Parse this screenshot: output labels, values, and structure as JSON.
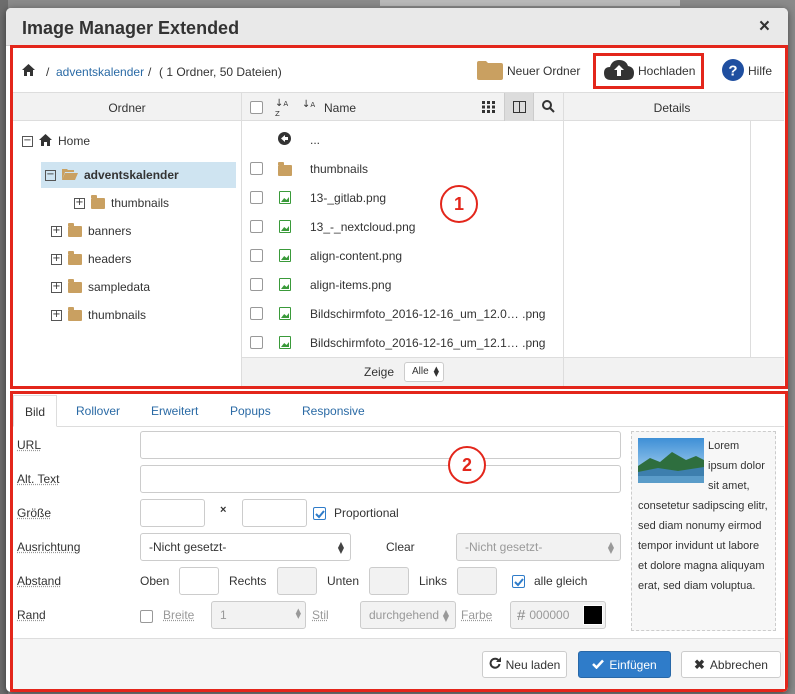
{
  "dialog": {
    "title": "Image Manager Extended",
    "close": "×"
  },
  "topbar": {
    "path_separator": "/",
    "path_folder": "adventskalender",
    "path_info": "( 1 Ordner, 50 Dateien)",
    "new_folder": "Neuer Ordner",
    "upload": "Hochladen",
    "help": "Hilfe"
  },
  "headers": {
    "folders": "Ordner",
    "name": "Name",
    "details": "Details"
  },
  "tree": {
    "home": "Home",
    "selected": "adventskalender",
    "child": "thumbnails",
    "items": [
      "banners",
      "headers",
      "sampledata",
      "thumbnails"
    ]
  },
  "files": {
    "up": "...",
    "folder": "thumbnails",
    "items": [
      "13-_gitlab.png",
      "13_-_nextcloud.png",
      "align-content.png",
      "align-items.png",
      "Bildschirmfoto_2016-12-16_um_12.0… .png",
      "Bildschirmfoto_2016-12-16_um_12.1… .png"
    ]
  },
  "show": {
    "label": "Zeige",
    "value": "Alle"
  },
  "callouts": {
    "one": "1",
    "two": "2"
  },
  "tabs": [
    "Bild",
    "Rollover",
    "Erweitert",
    "Popups",
    "Responsive"
  ],
  "form": {
    "url": "URL",
    "alt": "Alt. Text",
    "size": "Größe",
    "times": "×",
    "proportional": "Proportional",
    "align": "Ausrichtung",
    "align_value": "-Nicht gesetzt-",
    "clear": "Clear",
    "clear_value": "-Nicht gesetzt-",
    "spacing": "Abstand",
    "top": "Oben",
    "right": "Rechts",
    "bottom": "Unten",
    "left": "Links",
    "all_equal": "alle gleich",
    "border": "Rand",
    "width": "Breite",
    "width_value": "1",
    "style": "Stil",
    "style_value": "durchgehend",
    "color": "Farbe",
    "color_value": "000000"
  },
  "preview": {
    "text": "Lorem ipsum dolor sit amet, consetetur sadipscing elitr, sed diam nonumy eirmod tempor invidunt ut labore et dolore magna aliquyam erat, sed diam voluptua."
  },
  "footer": {
    "reload": "Neu laden",
    "insert": "Einfügen",
    "cancel": "Abbrechen"
  },
  "colors": {
    "accent": "#2f7cc9",
    "highlight": "#e3261b",
    "folder": "#c9a061",
    "selected_row": "#cfe4f1"
  }
}
